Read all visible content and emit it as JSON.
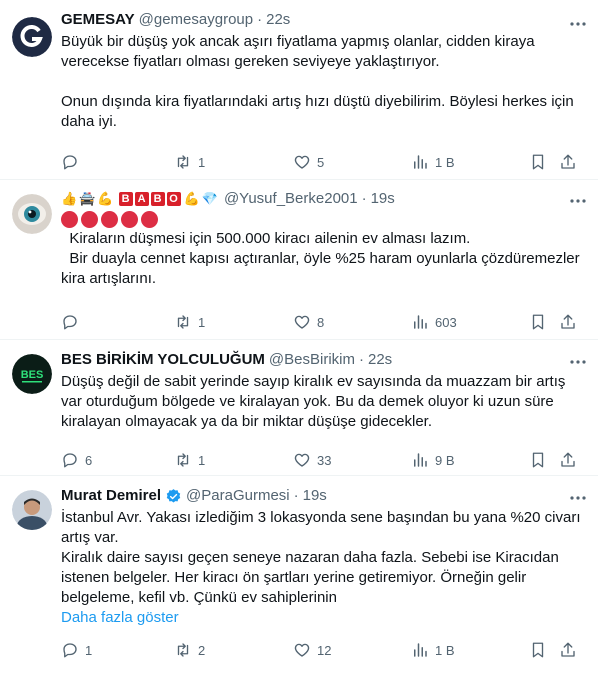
{
  "tweets": [
    {
      "name": "GEMESAY",
      "handle": "@gemesaygroup",
      "time": "22s",
      "text": "Büyük bir düşüş yok ancak aşırı fiyatlama yapmış olanlar, cidden kiraya verecekse fiyatları olması gereken seviyeye yaklaştırıyor.\n\nOnun dışında kira fiyatlarındaki artış hızı düştü diyebilirim. Böylesi herkes için daha iyi.",
      "replies": "",
      "retweets": "1",
      "likes": "5",
      "views": "1 B"
    },
    {
      "name": "",
      "handle": "@Yusuf_Berke2001",
      "time": "19s",
      "babo": [
        "B",
        "A",
        "B",
        "O"
      ],
      "text": "  Kiraların düşmesi için 500.000 kiracı ailenin ev alması lazım.\n  Bir duayla cennet kapısı açtıranlar, öyle %25 haram oyunlarla çözdüremezler kira artışlarını.",
      "replies": "",
      "retweets": "1",
      "likes": "8",
      "views": "603"
    },
    {
      "name": "BES BİRİKİM YOLCULUĞUM",
      "handle": "@BesBirikim",
      "time": "22s",
      "text": "Düşüş değil de sabit yerinde sayıp kiralık ev sayısında da muazzam bir artış var oturduğum bölgede ve kiralayan yok. Bu da demek oluyor ki uzun süre kiralayan olmayacak ya da bir miktar düşüşe gidecekler.",
      "replies": "6",
      "retweets": "1",
      "likes": "33",
      "views": "9 B"
    },
    {
      "name": "Murat Demirel",
      "handle": "@ParaGurmesi",
      "time": "19s",
      "text": "İstanbul Avr. Yakası izlediğim 3 lokasyonda sene başından bu yana %20 civarı artış var.\nKiralık daire sayısı geçen seneye nazaran daha fazla. Sebebi ise Kiracıdan istenen belgeler. Her kiracı ön şartları yerine getiremiyor. Örneğin gelir belgeleme, kefil vb. Çünkü ev sahiplerinin",
      "show_more": "Daha fazla göster",
      "replies": "1",
      "retweets": "2",
      "likes": "12",
      "views": "1 B"
    }
  ],
  "dot": "·",
  "bes_logo_text": "BES"
}
